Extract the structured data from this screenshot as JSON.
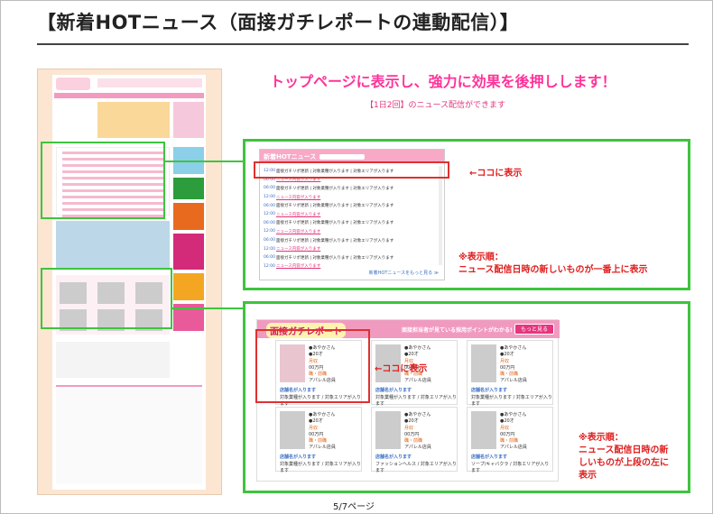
{
  "slide": {
    "title": "【新着HOTニュース（面接ガチレポートの連動配信）】",
    "tagline": "トップページに表示し、強力に効果を後押しします！",
    "subline": "【1日2回】のニュース配信ができます",
    "page_number": "5/7ページ"
  },
  "news_panel": {
    "header": "新着HOTニュース",
    "rows": [
      {
        "date": "12:00",
        "text": "面接ガチリポ更新 | 対象業種が入ります | 対象エリアが入ります"
      },
      {
        "date": "06:00",
        "text": "ニュース内容が入ります",
        "link": true
      },
      {
        "date": "06:00",
        "text": "面接ガチリポ更新 | 対象業種が入ります | 対象エリアが入ります"
      },
      {
        "date": "12:00",
        "text": "ニュース内容が入ります",
        "link": true
      },
      {
        "date": "06:00",
        "text": "面接ガチリポ更新 | 対象業種が入ります | 対象エリアが入ります"
      },
      {
        "date": "12:00",
        "text": "ニュース内容が入ります",
        "link": true
      },
      {
        "date": "06:00",
        "text": "面接ガチリポ更新 | 対象業種が入ります | 対象エリアが入ります"
      },
      {
        "date": "12:00",
        "text": "ニュース内容が入ります",
        "link": true
      },
      {
        "date": "06:00",
        "text": "面接ガチリポ更新 | 対象業種が入ります | 対象エリアが入ります"
      },
      {
        "date": "12:00",
        "text": "ニュース内容が入ります",
        "link": true
      },
      {
        "date": "06:00",
        "text": "面接ガチリポ更新 | 対象業種が入ります | 対象エリアが入ります"
      },
      {
        "date": "12:00",
        "text": "ニュース内容が入ります",
        "link": true
      }
    ],
    "more_link": "新着HOTニュースをもっと見る ≫",
    "callout": "←ココに表示",
    "note_line1": "※表示順：",
    "note_line2": "ニュース配信日時の新しいものが一番上に表示"
  },
  "gachi_panel": {
    "logo": "面接ガチレポート",
    "desc": "面接担当者が見ている採用ポイントがわかる!",
    "more_button": "もっと見る",
    "callout": "←ココに表示",
    "note_line1": "※表示順：",
    "note_line2": "ニュース配信日時の新",
    "note_line3": "しいものが上段の左に",
    "note_line4": "表示",
    "cards": [
      {
        "name": "●あやかさん",
        "age": "●20才",
        "wage_label": "月収",
        "wage": "00万円",
        "job_label": "職・前職",
        "job": "アパレル店員",
        "shop": "店舗名が入ります",
        "area": "対象業種が入ります / 対象エリアが入ります"
      },
      {
        "name": "●あやかさん",
        "age": "●20才",
        "wage_label": "月収",
        "wage": "00万円",
        "job_label": "職・前職",
        "job": "アパレル店員",
        "shop": "店舗名が入ります",
        "area": "対象業種が入ります / 対象エリアが入ります"
      },
      {
        "name": "●あやかさん",
        "age": "●20才",
        "wage_label": "月収",
        "wage": "00万円",
        "job_label": "職・前職",
        "job": "アパレル店員",
        "shop": "店舗名が入ります",
        "area": "対象業種が入ります / 対象エリアが入ります"
      },
      {
        "name": "●あやかさん",
        "age": "●20才",
        "wage_label": "月収",
        "wage": "00万円",
        "job_label": "職・前職",
        "job": "アパレル店員",
        "shop": "店舗名が入ります",
        "area": "対象業種が入ります / 対象エリアが入ります"
      },
      {
        "name": "●あやかさん",
        "age": "●20才",
        "wage_label": "月収",
        "wage": "00万円",
        "job_label": "職・前職",
        "job": "アパレル店員",
        "shop": "店舗名が入ります",
        "area": "ファッションヘルス / 対象エリアが入ります"
      },
      {
        "name": "●あやかさん",
        "age": "●20才",
        "wage_label": "月収",
        "wage": "00万円",
        "job_label": "職・前職",
        "job": "アパレル店員",
        "shop": "店舗名が入ります",
        "area": "ソープ/キャバクラ / 対象エリアが入ります"
      }
    ]
  },
  "colors": {
    "accent": "#ff3399",
    "highlight": "#3ec43e",
    "callout": "#e02020"
  }
}
